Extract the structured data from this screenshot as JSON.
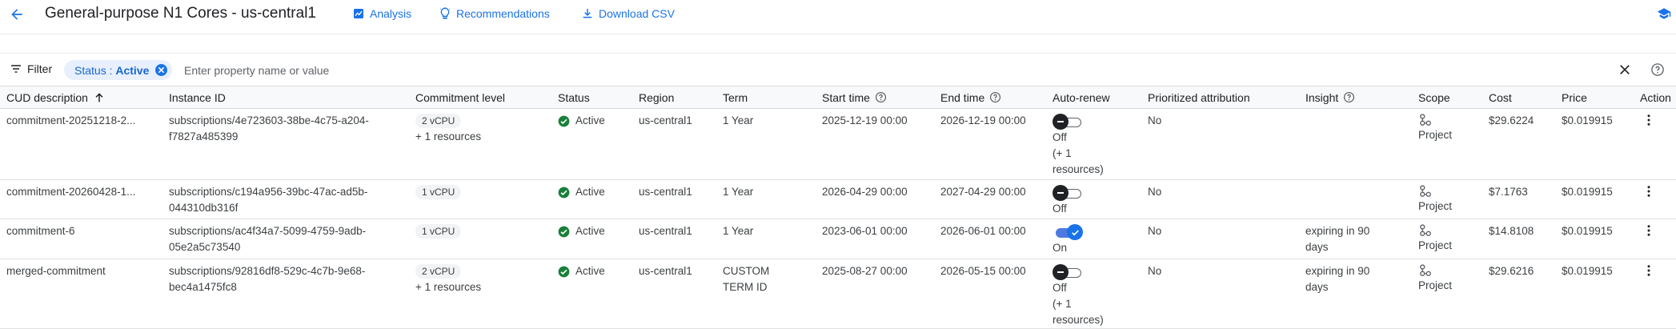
{
  "header": {
    "title": "General-purpose N1 Cores - us-central1",
    "analysis_label": "Analysis",
    "recommendations_label": "Recommendations",
    "download_label": "Download CSV"
  },
  "filter": {
    "label": "Filter",
    "chip_key": "Status : ",
    "chip_value": "Active",
    "placeholder": "Enter property name or value"
  },
  "table": {
    "columns": [
      "CUD description",
      "Instance ID",
      "Commitment level",
      "Status",
      "Region",
      "Term",
      "Start time",
      "End time",
      "Auto-renew",
      "Prioritized attribution",
      "Insight",
      "Scope",
      "Cost",
      "Price",
      "Action"
    ],
    "rows": [
      {
        "description": "commitment-20251218-2...",
        "instance_1": "subscriptions/4e723603-38be-4c75-a204-",
        "instance_2": "f7827a485399",
        "level": "2 vCPU",
        "level_extra": "+ 1 resources",
        "status": "Active",
        "region": "us-central1",
        "term_1": "1 Year",
        "term_2": "",
        "start": "2025-12-19 00:00",
        "end": "2026-12-19 00:00",
        "autorenew_on": false,
        "autorenew_1": "Off",
        "autorenew_2": "(+ 1",
        "autorenew_3": "resources)",
        "attribution": "No",
        "insight_1": "",
        "insight_2": "",
        "scope": "Project",
        "cost": "$29.6224",
        "price": "$0.019915"
      },
      {
        "description": "commitment-20260428-1...",
        "instance_1": "subscriptions/c194a956-39bc-47ac-ad5b-",
        "instance_2": "044310db316f",
        "level": "1 vCPU",
        "level_extra": "",
        "status": "Active",
        "region": "us-central1",
        "term_1": "1 Year",
        "term_2": "",
        "start": "2026-04-29 00:00",
        "end": "2027-04-29 00:00",
        "autorenew_on": false,
        "autorenew_1": "Off",
        "autorenew_2": "",
        "autorenew_3": "",
        "attribution": "No",
        "insight_1": "",
        "insight_2": "",
        "scope": "Project",
        "cost": "$7.1763",
        "price": "$0.019915"
      },
      {
        "description": "commitment-6",
        "instance_1": "subscriptions/ac4f34a7-5099-4759-9adb-",
        "instance_2": "05e2a5c73540",
        "level": "1 vCPU",
        "level_extra": "",
        "status": "Active",
        "region": "us-central1",
        "term_1": "1 Year",
        "term_2": "",
        "start": "2023-06-01 00:00",
        "end": "2026-06-01 00:00",
        "autorenew_on": true,
        "autorenew_1": "On",
        "autorenew_2": "",
        "autorenew_3": "",
        "attribution": "No",
        "insight_1": "expiring in 90",
        "insight_2": "days",
        "scope": "Project",
        "cost": "$14.8108",
        "price": "$0.019915"
      },
      {
        "description": "merged-commitment",
        "instance_1": "subscriptions/92816df8-529c-4c7b-9e68-",
        "instance_2": "bec4a1475fc8",
        "level": "2 vCPU",
        "level_extra": "+ 1 resources",
        "status": "Active",
        "region": "us-central1",
        "term_1": "CUSTOM",
        "term_2": "TERM ID",
        "start": "2025-08-27 00:00",
        "end": "2026-05-15 00:00",
        "autorenew_on": false,
        "autorenew_1": "Off",
        "autorenew_2": "(+ 1",
        "autorenew_3": "resources)",
        "attribution": "No",
        "insight_1": "expiring in 90",
        "insight_2": "days",
        "scope": "Project",
        "cost": "$29.6216",
        "price": "$0.019915"
      }
    ]
  },
  "icons": {
    "back": "arrow-back-icon",
    "analysis": "analytics-icon",
    "recommendations": "lightbulb-icon",
    "download": "download-icon",
    "corner": "school-cap-icon",
    "filter": "filter-lines-icon",
    "clear": "close-icon",
    "help": "help-circle-icon",
    "sort": "arrow-up-icon",
    "status": "check-circle-icon",
    "scope": "project-icon",
    "action": "more-vert-icon"
  },
  "colors": {
    "accent": "#1a73e8",
    "status_ok": "#188038",
    "chip_bg": "#e8f0fe",
    "header_bg": "#f8f9fa"
  }
}
